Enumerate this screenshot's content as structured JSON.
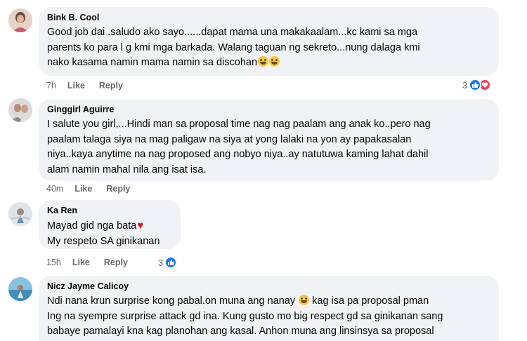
{
  "comments": [
    {
      "author": "Bink B. Cool",
      "text": "Good job dai .saludo ako sayo......dapat mama una makakaalam...kc kami sa mga\nparents ko para l g kmi mga barkada. Walang taguan ng sekreto...nung dalaga kmi\nnako kasama namin mama namin sa discohan",
      "emojis": [
        "rolling-on-floor-laughing-emoji",
        "rolling-on-floor-laughing-emoji"
      ],
      "time": "7h",
      "like_label": "Like",
      "reply_label": "Reply",
      "reaction_count": "3",
      "reactions": [
        "like",
        "love"
      ]
    },
    {
      "author": "Ginggirl Aguirre",
      "text": "I salute you girl,...Hindi man sa proposal time nag nag paalam ang anak ko..pero nag\npaalam talaga siya na mag paligaw na siya at yong lalaki na yon ay papakasalan\nniya..kaya anytime na nag proposed ang nobyo niya..ay natutuwa kaming lahat dahil\nalam namin mahal nila ang isat isa.",
      "time": "40m",
      "like_label": "Like",
      "reply_label": "Reply"
    },
    {
      "author": "Ka Ren",
      "line1": "Mayad gid nga bata",
      "line2": "My respeto SA ginikanan",
      "emoji": "red-heart-emoji",
      "time": "15h",
      "like_label": "Like",
      "reply_label": "Reply",
      "reaction_count": "3",
      "reactions": [
        "like"
      ]
    },
    {
      "author": "Nicz Jayme Calicoy",
      "line1a": "Ndi nana krun surprise kong pabal.on muna ang nanay ",
      "line1b": " kag isa pa proposal pman",
      "rest": "Ing na syempre surprise attack gd ina. Kung gusto mo big respect gd sa ginikanan sang\nbabaye pamalayi kna kag planohan ang kasal. Anhon muna ang linsinsya sa proposal",
      "emoji": "grinning-face-emoji"
    }
  ],
  "colors": {
    "bubble": "#f0f2f5",
    "meta": "#65676b",
    "like_blue": "#1877f2",
    "love_red": "#f33e58"
  }
}
